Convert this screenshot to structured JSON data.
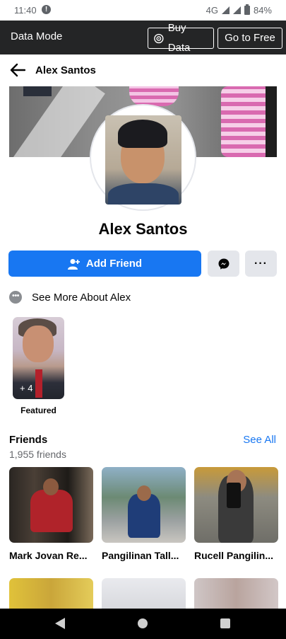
{
  "status_bar": {
    "time": "11:40",
    "network": "4G",
    "battery": "84%"
  },
  "data_mode": {
    "label": "Data Mode",
    "buy_data": "Buy Data",
    "go_free": "Go to Free"
  },
  "header": {
    "title": "Alex Santos"
  },
  "profile": {
    "name": "Alex Santos",
    "add_friend_label": "Add Friend",
    "see_more_label": "See More About Alex"
  },
  "featured": {
    "count_label": "+ 4",
    "label": "Featured"
  },
  "friends": {
    "title": "Friends",
    "count": "1,955 friends",
    "see_all": "See All",
    "items": [
      {
        "name": "Mark Jovan Re..."
      },
      {
        "name": "Pangilinan Tall..."
      },
      {
        "name": "Rucell Pangilin..."
      }
    ]
  },
  "colors": {
    "primary": "#1877f2",
    "data_bar": "#242526",
    "button_gray": "#e4e6eb"
  }
}
